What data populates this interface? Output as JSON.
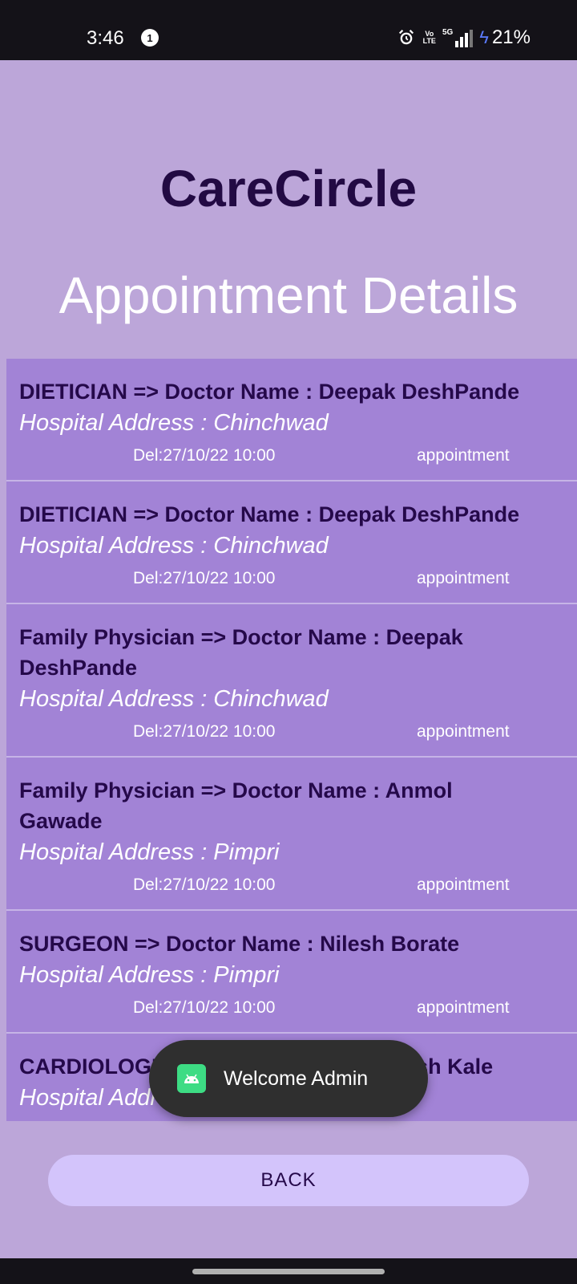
{
  "status_bar": {
    "time": "3:46",
    "notification_count": "1",
    "volte_line1": "Vo",
    "volte_line2": "LTE",
    "network": "5G",
    "battery": "21%",
    "icons": [
      "alarm-icon",
      "signal-icon",
      "charging-bolt-icon"
    ]
  },
  "header": {
    "app_name": "CareCircle",
    "page_title": "Appointment Details"
  },
  "appointments": [
    {
      "title": "DIETICIAN => Doctor Name : Deepak DeshPande",
      "address": "Hospital Address : Chinchwad",
      "date": "Del:27/10/22 10:00",
      "type": "appointment"
    },
    {
      "title": "DIETICIAN => Doctor Name : Deepak DeshPande",
      "address": "Hospital Address : Chinchwad",
      "date": "Del:27/10/22 10:00",
      "type": "appointment"
    },
    {
      "title": "Family Physician => Doctor Name : Deepak DeshPande",
      "address": "Hospital Address : Chinchwad",
      "date": "Del:27/10/22 10:00",
      "type": "appointment"
    },
    {
      "title": "Family Physician => Doctor Name : Anmol Gawade",
      "address": "Hospital Address : Pimpri",
      "date": "Del:27/10/22 10:00",
      "type": "appointment"
    },
    {
      "title": "SURGEON => Doctor Name : Nilesh Borate",
      "address": "Hospital Address : Pimpri",
      "date": "Del:27/10/22 10:00",
      "type": "appointment"
    },
    {
      "title": "CARDIOLOGIST => Doctor Name : Nilesh Kale",
      "address": "Hospital Address : Pimpri",
      "date": "",
      "type": ""
    }
  ],
  "toast": {
    "message": "Welcome Admin",
    "icon": "android-icon"
  },
  "footer": {
    "back_label": "BACK"
  },
  "colors": {
    "background": "#bca6d9",
    "list_background": "#a283d6",
    "title_dark": "#220a43",
    "button": "#d3c4fb"
  }
}
